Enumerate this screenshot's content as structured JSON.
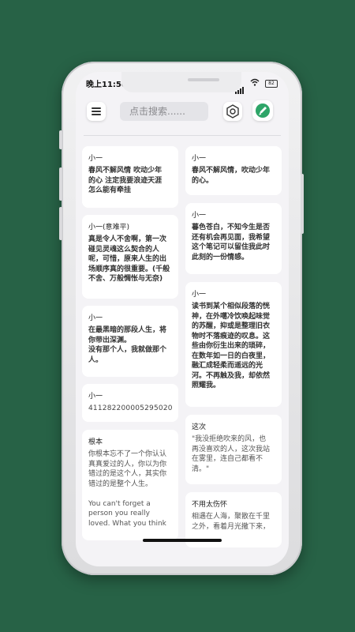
{
  "status": {
    "time": "晚上11:50",
    "battery": "82"
  },
  "toolbar": {
    "search_placeholder": "点击搜索......",
    "menu_icon": "menu-icon",
    "settings_icon": "gear-icon",
    "edit_icon": "edit-icon",
    "accent": "#2ea568"
  },
  "left_column": [
    {
      "title": "小一",
      "body": "春风不解风情  吹动少年\n的心  注定我要浪迹天涯\n 怎么能有牵挂",
      "style": "bold"
    },
    {
      "title": "小一(意难平)",
      "body": "真是令人不舍啊，第一次\n碰见灵魂这么契合的人\n呢，可惜，原来人生的出\n场顺序真的很重要。(千般\n不舍、万般惆怅与无奈)",
      "style": "bold"
    },
    {
      "title": "小一",
      "body": "在最黑暗的那段人生，将\n你带出深渊。\n没有那个人，我就做那个\n人。",
      "style": "bold"
    },
    {
      "title": "小一",
      "body": "411282200005295020",
      "style": "mono"
    },
    {
      "title": "根本",
      "body": "你根本忘不了一个你认认\n真真爱过的人，你以为你\n错过的是这个人，其实你\n错过的是整个人生。\n\nYou can't forget a\nperson you really\nloved. What you think",
      "style": "light"
    }
  ],
  "right_column": [
    {
      "title": "小一",
      "body": "春风不解风情，吹动少年\n的心。",
      "style": "bold"
    },
    {
      "title": "小一",
      "body": "暮色苍白，不知今生是否\n还有机会再见面，我希望\n这个笔记可以留住我此时\n此刻的一份情感。",
      "style": "bold"
    },
    {
      "title": "小一",
      "body": "读书到某个相似段落的恍\n神，在外噶冷饮唤起味觉\n的苏醒，抑或是整理旧衣\n物时不落痕迹的叹息。这\n些由你衍生出来的琐碎，\n在数年如一日的白夜里，\n融汇成轻柔而遥远的光\n河。不再触及我，却依然\n照耀我。",
      "style": "bold"
    },
    {
      "title": "这次",
      "body": "\"我没拒绝吹来的风，也\n再没喜欢的人，这次我站\n在雾里，连自己都看不\n清。\"",
      "style": "light"
    },
    {
      "title": "不用太伤怀",
      "body": "相遇在人海，聚散在千里\n之外，看着月光撒下来，\n",
      "style": "light"
    }
  ]
}
